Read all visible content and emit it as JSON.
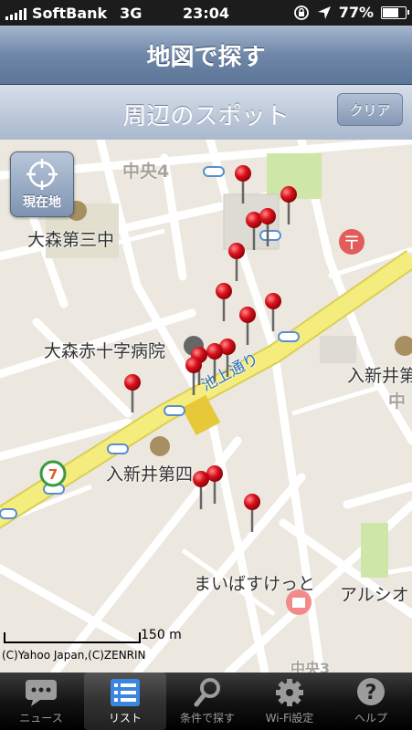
{
  "status": {
    "carrier": "SoftBank",
    "network": "3G",
    "time": "23:04",
    "battery_text": "77%",
    "battery_level": 0.77
  },
  "nav": {
    "title": "地図で探す"
  },
  "subbar": {
    "title": "周辺のスポット",
    "clear_label": "クリア"
  },
  "map": {
    "location_button_label": "現在地",
    "labels": {
      "chuo4": "中央4",
      "omori_daisan": "大森第三中",
      "omori_hospital": "大森赤十字病院",
      "iriarai": "入新井第",
      "iriarai_shi": "入新井第四",
      "ikegami_dori": "池上通り",
      "mybasket": "まいばすけっと",
      "arushio": "アルシオ",
      "naka": "中",
      "naka3": "中央3"
    },
    "scale_label": "150 m",
    "copyright": "(C)Yahoo Japan,(C)ZENRIN"
  },
  "tabbar": {
    "items": [
      {
        "label": "ニュース",
        "icon": "speech-bubble-icon"
      },
      {
        "label": "リスト",
        "icon": "list-icon"
      },
      {
        "label": "条件で探す",
        "icon": "magnifier-icon"
      },
      {
        "label": "Wi-Fi設定",
        "icon": "gear-icon"
      },
      {
        "label": "ヘルプ",
        "icon": "help-icon"
      }
    ],
    "active_index": 1
  },
  "colors": {
    "pin": "#d8101b",
    "major_road": "#f5ec7e",
    "nav": "#6f87a8"
  }
}
